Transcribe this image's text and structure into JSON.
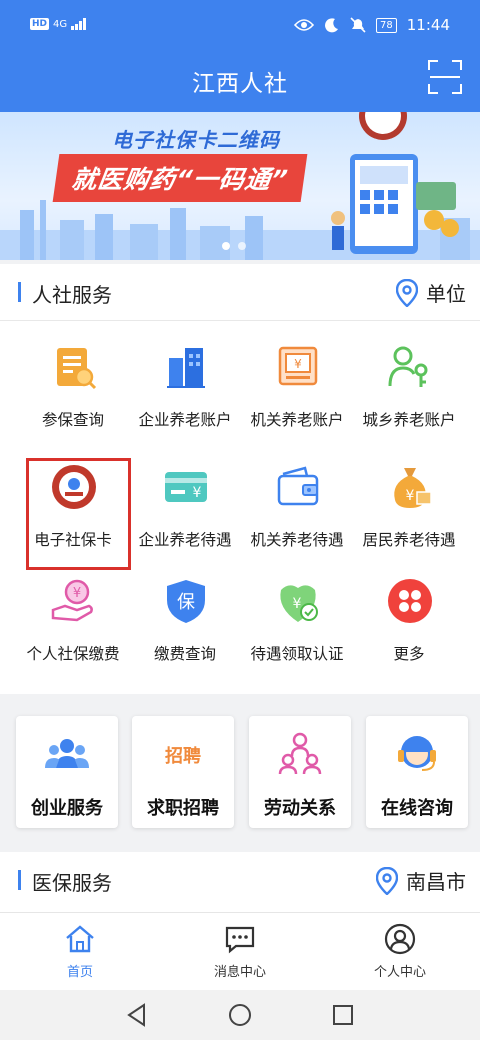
{
  "status": {
    "hd": "HD",
    "net": "4G",
    "battery": "78",
    "time": "11:44"
  },
  "header": {
    "title": "江西人社"
  },
  "banner": {
    "line1": "电子社保卡二维码",
    "line2": "就医购药“一码通”"
  },
  "renshe": {
    "title": "人社服务",
    "location": "单位",
    "items": [
      {
        "label": "参保查询",
        "icon": "clipboard-search-icon"
      },
      {
        "label": "企业养老账户",
        "icon": "building-icon"
      },
      {
        "label": "机关养老账户",
        "icon": "money-box-icon"
      },
      {
        "label": "城乡养老账户",
        "icon": "person-key-icon"
      },
      {
        "label": "电子社保卡",
        "icon": "social-security-card-icon"
      },
      {
        "label": "企业养老待遇",
        "icon": "card-yuan-icon"
      },
      {
        "label": "机关养老待遇",
        "icon": "wallet-icon"
      },
      {
        "label": "居民养老待遇",
        "icon": "money-bag-icon"
      },
      {
        "label": "个人社保缴费",
        "icon": "hand-yuan-icon"
      },
      {
        "label": "缴费查询",
        "icon": "shield-bao-icon"
      },
      {
        "label": "待遇领取认证",
        "icon": "verify-yuan-icon"
      },
      {
        "label": "更多",
        "icon": "more-icon"
      }
    ]
  },
  "tiles": [
    {
      "label": "创业服务",
      "icon": "team-icon"
    },
    {
      "label": "求职招聘",
      "icon": "recruit-icon"
    },
    {
      "label": "劳动关系",
      "icon": "org-chart-icon"
    },
    {
      "label": "在线咨询",
      "icon": "headset-icon"
    }
  ],
  "recruit_glyph": "招聘",
  "yibao": {
    "title": "医保服务",
    "location": "南昌市"
  },
  "tabbar": [
    {
      "label": "首页",
      "icon": "home-icon",
      "active": true
    },
    {
      "label": "消息中心",
      "icon": "message-icon",
      "active": false
    },
    {
      "label": "个人中心",
      "icon": "user-icon",
      "active": false
    }
  ],
  "colors": {
    "primary": "#3e82ee",
    "highlight": "#d9312b",
    "banner_red": "#e8453c"
  }
}
